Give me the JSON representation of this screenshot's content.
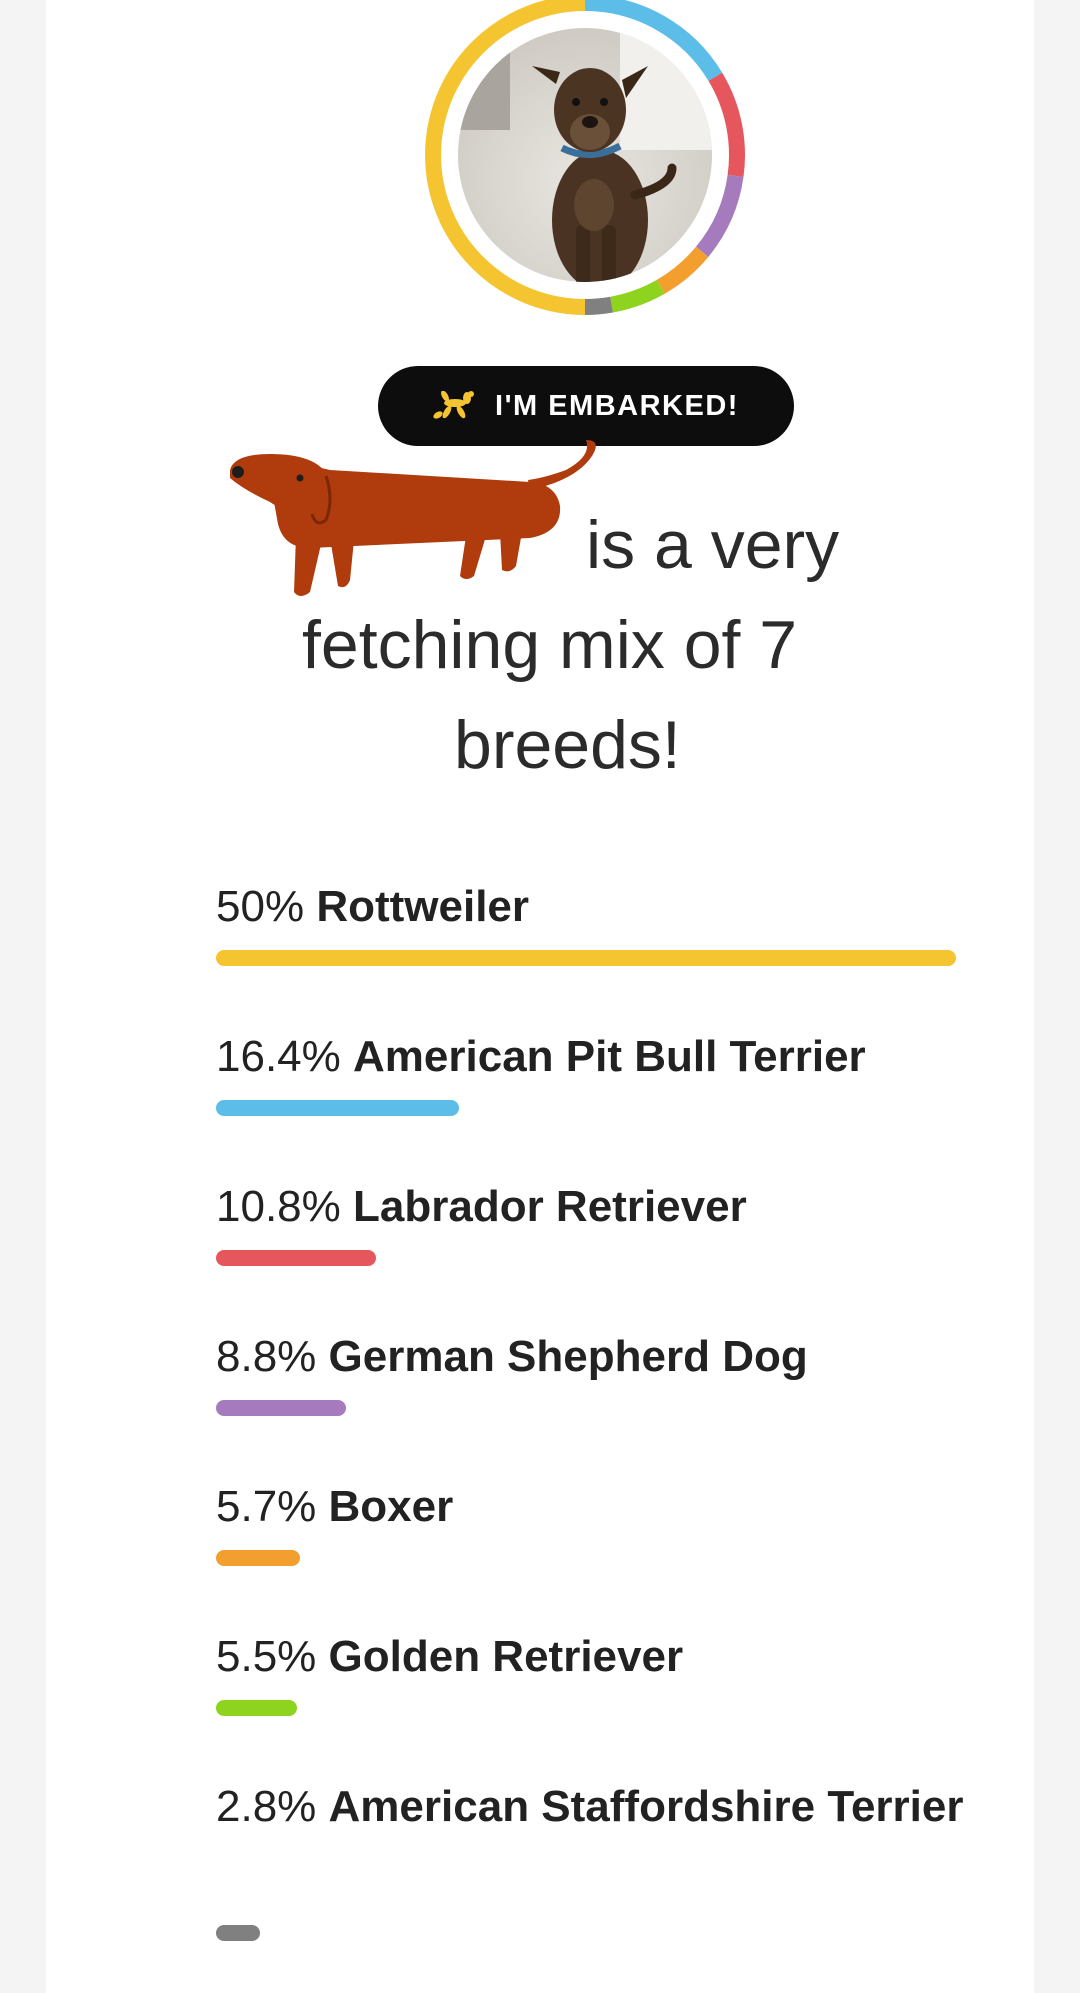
{
  "badge": {
    "label": "I'M EMBARKED!",
    "icon": "balloon-dog-icon",
    "icon_color": "#f5c431"
  },
  "headline": {
    "line1": "is a very",
    "line2": "fetching mix of 7",
    "line3": "breeds!"
  },
  "sticker": {
    "icon": "dachshund-icon",
    "color": "#b03c0e"
  },
  "ring_colors": [
    "#f5c431",
    "#5bbde8",
    "#e5575d",
    "#a57bbd",
    "#f29f2f",
    "#8ed31e",
    "#8a8a8a"
  ],
  "breeds": [
    {
      "percent": "50%",
      "name": "Rottweiler",
      "share": 0.5,
      "color": "#f5c431"
    },
    {
      "percent": "16.4%",
      "name": "American Pit Bull Terrier",
      "share": 0.164,
      "color": "#5bbde8"
    },
    {
      "percent": "10.8%",
      "name": "Labrador Retriever",
      "share": 0.108,
      "color": "#e5575d"
    },
    {
      "percent": "8.8%",
      "name": "German Shepherd Dog",
      "share": 0.088,
      "color": "#a57bbd"
    },
    {
      "percent": "5.7%",
      "name": "Boxer",
      "share": 0.057,
      "color": "#f29f2f"
    },
    {
      "percent": "5.5%",
      "name": "Golden Retriever",
      "share": 0.055,
      "color": "#8ed31e"
    },
    {
      "percent": "2.8%",
      "name": "American Staffordshire Terrier",
      "share": 0.028,
      "color": "#808080"
    }
  ]
}
